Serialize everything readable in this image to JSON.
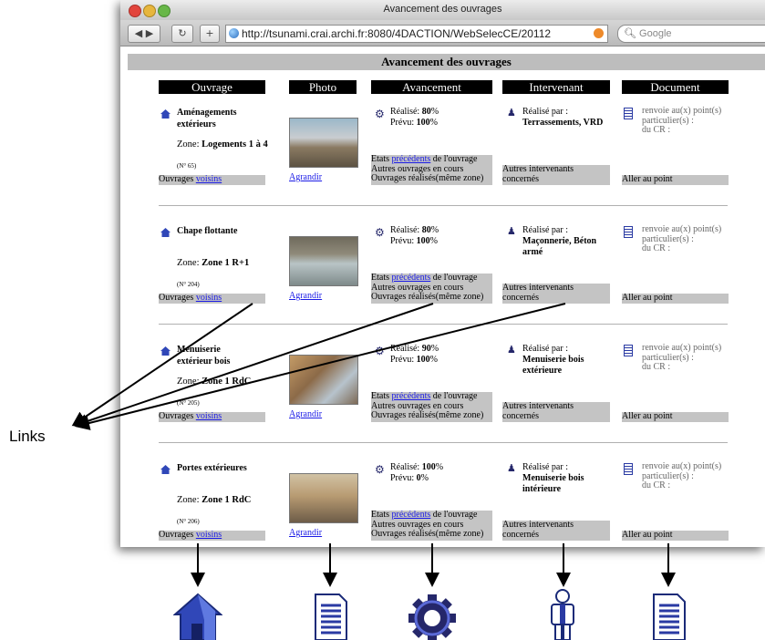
{
  "window": {
    "title": "Avancement des ouvrages",
    "url": "http://tsunami.crai.archi.fr:8080/4DACTION/WebSelecCE/20112",
    "search_placeholder": "Google"
  },
  "page": {
    "header": "Avancement des ouvrages",
    "columns": [
      "Ouvrage",
      "Photo",
      "Avancement",
      "Intervenant",
      "Document"
    ]
  },
  "labels": {
    "realise": "Réalisé:",
    "prevu": "Prévu:",
    "realise_par": "Réalisé par :",
    "zone": "Zone:",
    "ouvrages": "Ouvrages ",
    "voisins": "voisins",
    "agrandir": "Agrandir",
    "etats": "Etats ",
    "precedents": "précédents",
    "de_ouvrage": " de l'ouvrage",
    "autres_en_cours": "Autres ouvrages en cours",
    "realises_zone": "Ouvrages réalisés(même zone)",
    "autres_intervenants_1": "Autres intervenants",
    "autres_intervenants_2": "concernés",
    "document_text_1": "renvoie au(x) point(s)",
    "document_text_2": "particulier(s) :",
    "document_text_3": "du CR :",
    "aller_au_point": "Aller au point"
  },
  "rows": [
    {
      "title": "Aménagements extérieurs",
      "zone": "Logements 1 à 4",
      "num": "(N° 65)",
      "realise": "80",
      "prevu": "100",
      "intervenant": "Terrassements, VRD"
    },
    {
      "title": "Chape flottante",
      "zone": "Zone 1 R+1",
      "num": "(N° 204)",
      "realise": "80",
      "prevu": "100",
      "intervenant": "Maçonnerie, Béton armé"
    },
    {
      "title": "Menuiserie extérieur bois",
      "zone": "Zone 1 RdC",
      "num": "(N° 205)",
      "realise": "90",
      "prevu": "100",
      "intervenant": "Menuiserie bois extérieure"
    },
    {
      "title": "Portes extérieures",
      "zone": "Zone 1 RdC",
      "num": "(N° 206)",
      "realise": "100",
      "prevu": "0",
      "intervenant": "Menuiserie bois intérieure"
    }
  ],
  "annotation": {
    "links_label": "Links"
  },
  "colors": {
    "icon_blue": "#2a3aa3",
    "gray_bar": "#c4c4c4",
    "link_blue": "#1a1ae6"
  }
}
